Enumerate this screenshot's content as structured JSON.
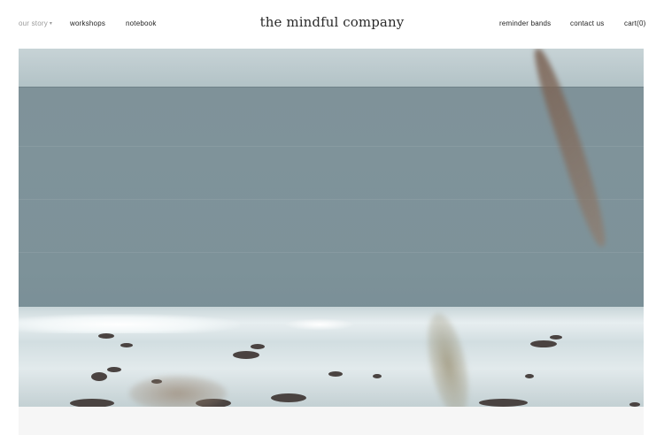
{
  "nav": {
    "left": [
      {
        "label": "our story",
        "dropdown": true
      },
      {
        "label": "workshops"
      },
      {
        "label": "notebook"
      }
    ],
    "right": [
      {
        "label": "reminder bands"
      },
      {
        "label": "contact us"
      },
      {
        "label": "cart(0)"
      }
    ]
  },
  "brand": {
    "title": "the mindful company"
  },
  "hero": {
    "icon": "ocean-photo"
  },
  "colors": {
    "text": "#222222",
    "muted": "#9a9a9a",
    "background": "#ffffff"
  }
}
